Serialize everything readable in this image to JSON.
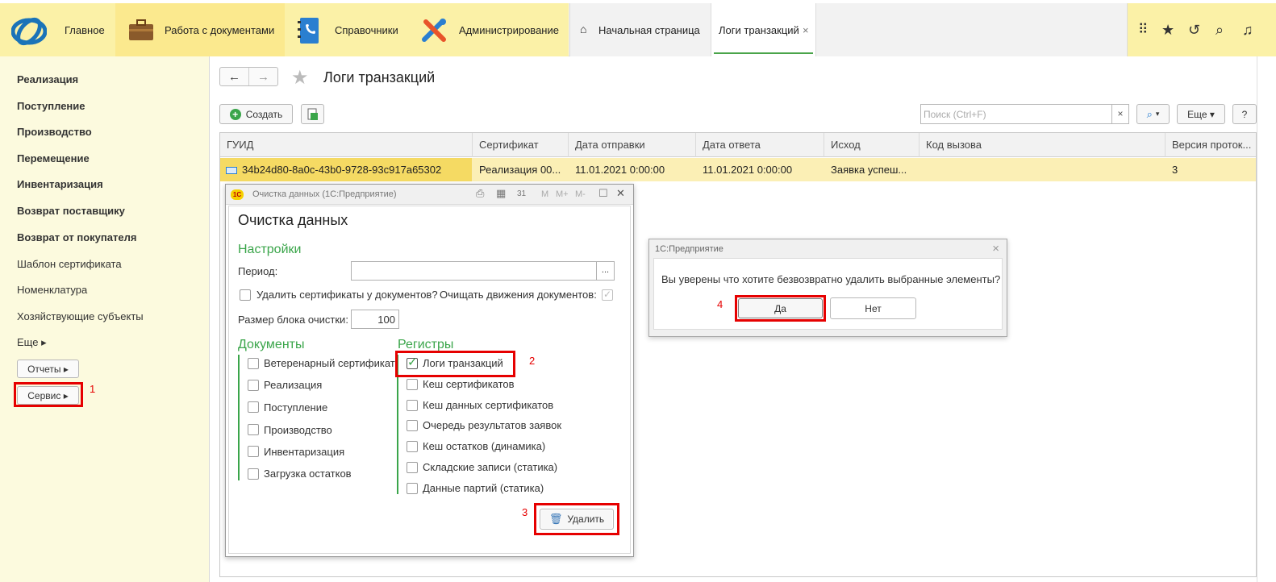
{
  "topbar": {
    "sections": [
      {
        "label": "Главное",
        "icon": "1c-logo-icon"
      },
      {
        "label": "Работа с документами",
        "icon": "briefcase-icon"
      },
      {
        "label": "Справочники",
        "icon": "phonebook-icon"
      },
      {
        "label": "Администрирование",
        "icon": "tools-icon"
      }
    ],
    "tabs": [
      {
        "label": "Начальная страница",
        "icon": "home-icon"
      },
      {
        "label": "Логи транзакций",
        "close": "×"
      }
    ],
    "icons": [
      "apps-grid-icon",
      "favorites-star-icon",
      "history-icon",
      "search-icon",
      "bell-icon"
    ]
  },
  "sidebar": {
    "items": [
      "Реализация",
      "Поступление",
      "Производство",
      "Перемещение",
      "Инвентаризация",
      "Возврат поставщику",
      "Возврат от покупателя",
      "Шаблон сертификата",
      "Номенклатура",
      "Хозяйствующие субъекты",
      "Еще ▸"
    ],
    "reports_button": "Отчеты ▸",
    "service_button": "Сервис ▸"
  },
  "page": {
    "title": "Логи транзакций",
    "create_button": "Создать",
    "search_placeholder": "Поиск (Ctrl+F)",
    "search_clear": "×",
    "more_button": "Еще ▾",
    "help_button": "?"
  },
  "table": {
    "columns": [
      "ГУИД",
      "Сертификат",
      "Дата отправки",
      "Дата ответа",
      "Исход",
      "Код вызова",
      "Версия проток..."
    ],
    "rows": [
      [
        "34b24d80-8a0c-43b0-9728-93c917a65302",
        "Реализация 00...",
        "11.01.2021 0:00:00",
        "11.01.2021 0:00:00",
        "Заявка успеш...",
        "",
        "3"
      ]
    ]
  },
  "cleanup_window": {
    "window_title": "Очистка данных (1С:Предприятие)",
    "title": "Очистка данных",
    "settings_header": "Настройки",
    "period_label": "Период:",
    "period_button": "...",
    "delete_certs_label": "Удалить сертификаты у документов?",
    "clear_movements_label": "Очищать движения документов:",
    "block_size_label": "Размер блока очистки:",
    "block_size_value": "100",
    "documents_header": "Документы",
    "documents": [
      "Ветеренарный сертификат",
      "Реализация",
      "Поступление",
      "Производство",
      "Инвентаризация",
      "Загрузка остатков"
    ],
    "registers_header": "Регистры",
    "registers": [
      {
        "label": "Логи транзакций",
        "checked": true
      },
      {
        "label": "Кеш сертификатов",
        "checked": false
      },
      {
        "label": "Кеш данных сертификатов",
        "checked": false
      },
      {
        "label": "Очередь результатов заявок",
        "checked": false
      },
      {
        "label": "Кеш остатков (динамика)",
        "checked": false
      },
      {
        "label": "Складские записи (статика)",
        "checked": false
      },
      {
        "label": "Данные партий (статика)",
        "checked": false
      }
    ],
    "delete_button": "Удалить",
    "toolbar": [
      "M",
      "M+",
      "M-"
    ]
  },
  "confirm_dialog": {
    "title": "1С:Предприятие",
    "close": "×",
    "message": "Вы уверены что хотите безвозвратно удалить выбранные элементы?",
    "yes": "Да",
    "no": "Нет"
  },
  "annotations": [
    "1",
    "2",
    "3",
    "4"
  ],
  "colors": {
    "accent": "#3aa54a",
    "highlight": "#e60000",
    "section_bg": "#fbf1a7",
    "row_bg": "#fbefb5"
  }
}
